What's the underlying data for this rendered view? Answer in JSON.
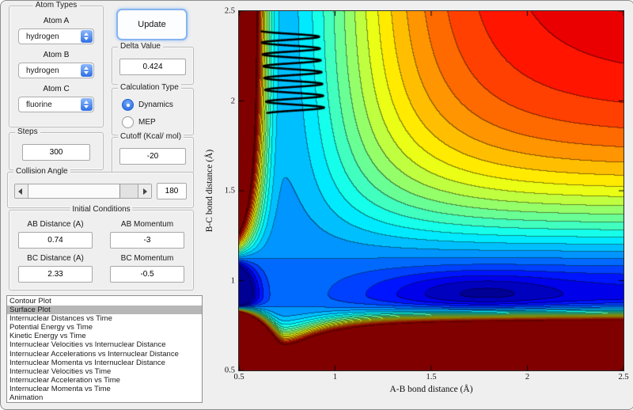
{
  "panels": {
    "atom_types": {
      "title": "Atom Types",
      "fields": [
        {
          "label": "Atom A",
          "value": "hydrogen"
        },
        {
          "label": "Atom B",
          "value": "hydrogen"
        },
        {
          "label": "Atom C",
          "value": "fluorine"
        }
      ]
    },
    "update_label": "Update",
    "delta": {
      "title": "Delta Value",
      "value": "0.424"
    },
    "calc_type": {
      "title": "Calculation Type",
      "options": [
        {
          "label": "Dynamics",
          "selected": true
        },
        {
          "label": "MEP",
          "selected": false
        }
      ]
    },
    "steps": {
      "title": "Steps",
      "value": "300"
    },
    "cutoff": {
      "title": "Cutoff (Kcal/ mol)",
      "value": "-20"
    },
    "collision": {
      "title": "Collision Angle",
      "value": "180"
    },
    "initial": {
      "title": "Initial Conditions",
      "fields": [
        {
          "label": "AB Distance (A)",
          "value": "0.74"
        },
        {
          "label": "AB Momentum",
          "value": "-3"
        },
        {
          "label": "BC Distance (A)",
          "value": "2.33"
        },
        {
          "label": "BC Momentum",
          "value": "-0.5"
        }
      ]
    },
    "plot_list": {
      "selected_index": 1,
      "items": [
        "Contour Plot",
        "Surface Plot",
        "Internuclear Distances vs Time",
        "Potential Energy vs Time",
        "Kinetic Energy vs Time",
        "Internuclear Velocities vs Internuclear Distance",
        "Internuclear Accelerations vs Internuclear Distance",
        "Internuclear Momenta vs Internuclear Distance",
        "Internuclear Velocities vs Time",
        "Internuclear Acceleration vs Time",
        "Internuclear Momenta vs Time",
        "Animation"
      ]
    }
  },
  "chart_data": {
    "type": "contour",
    "title": "",
    "xlabel": "A-B bond distance (Å)",
    "ylabel": "B-C bond distance (Å)",
    "xlim": [
      0.5,
      2.5
    ],
    "ylim": [
      0.5,
      2.5
    ],
    "xticks": [
      "0.5",
      "1",
      "1.5",
      "2",
      "2.5"
    ],
    "yticks": [
      "0.5",
      "1",
      "1.5",
      "2",
      "2.5"
    ],
    "xtick_values": [
      0.5,
      1,
      1.5,
      2,
      2.5
    ],
    "ytick_values": [
      0.5,
      1,
      1.5,
      2,
      2.5
    ],
    "colormap": "jet",
    "grid": false,
    "surface": {
      "description": "LEPS-like potential energy surface: filled contours, low-energy L-shaped valley along A-B=0.74 (vertical channel) and B-C=0.92 (horizontal channel, deepest near A-B=1.75), repulsive dark-red walls at small distances, high red plateau at large distances",
      "morse_ab": {
        "re": 0.74,
        "D": 4.5,
        "a_rep": 5.0,
        "a_att": 2.6
      },
      "morse_bc": {
        "re": 0.92,
        "D": 6.0,
        "a_rep": 5.0,
        "a_att": 2.6
      },
      "coupling": 0.9,
      "well": {
        "x": 1.75,
        "y": 0.93,
        "depth": 0.7,
        "wx": 0.18,
        "wy": 0.012
      },
      "vmin": -6.8,
      "vmax": 0.4,
      "levels": 24
    },
    "trajectory": {
      "description": "black zigzag dynamics trajectory (vibrating A-B while B-C decreases) in entrance channel",
      "y_start": 2.39,
      "y_end": 1.93,
      "x_center_start": 0.765,
      "x_center_end": 0.795,
      "amplitude": 0.15,
      "cycles": 7,
      "line_width": 2.6,
      "color": "#000000"
    }
  }
}
